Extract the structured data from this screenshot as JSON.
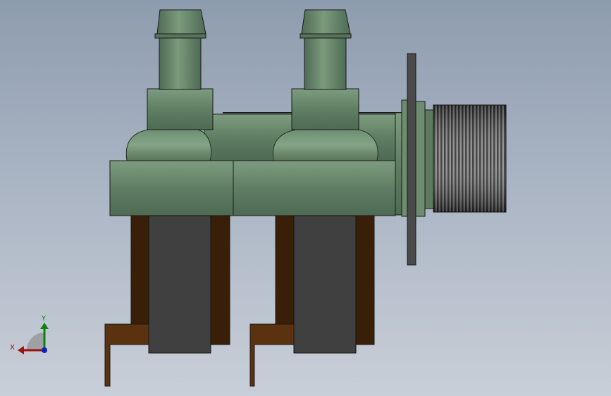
{
  "scene": {
    "description_label": "",
    "colors": {
      "background_top": "#8e9caf",
      "background_bottom": "#c9cfd8",
      "body_green": "#5e7a62",
      "body_green_light": "#7a9a7c",
      "coil_dark": "#3f3f3f",
      "bracket_brown": "#3a1f08",
      "terminal_brown": "#5a3210",
      "thread_dark": "#3a3a3a"
    }
  },
  "triad": {
    "x_label": "X",
    "y_label": "Y",
    "x_color": "#a01010",
    "y_color": "#108010",
    "z_color": "#1020c0"
  }
}
